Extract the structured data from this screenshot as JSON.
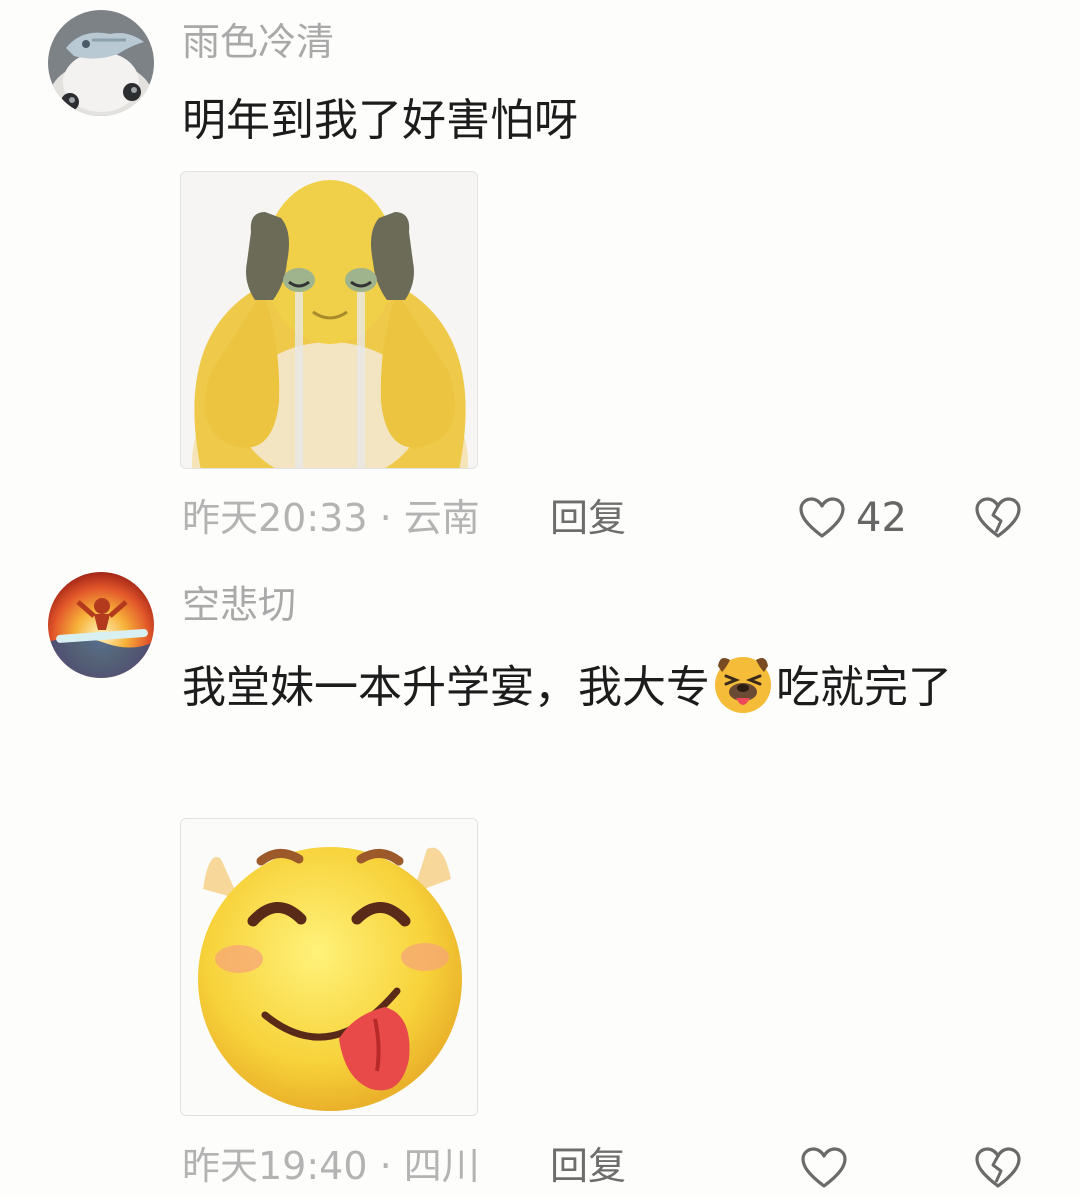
{
  "comments": [
    {
      "username": "雨色冷清",
      "text": "明年到我了好害怕呀",
      "time": "昨天20:33",
      "separator": "·",
      "location": "云南",
      "reply_label": "回复",
      "like_count": "42",
      "image_icon": "crying-yellow-character-sticker",
      "avatar_icon": "cat-with-fish-avatar"
    },
    {
      "username": "空悲切",
      "text_before": "我堂妹一本升学宴，我大专",
      "inline_emoji": "dog-tongue-emoji",
      "text_after": "吃就完了",
      "time": "昨天19:40",
      "separator": "·",
      "location": "四川",
      "reply_label": "回复",
      "image_icon": "smiling-tongue-emoji-sticker",
      "avatar_icon": "fire-surfer-avatar"
    }
  ],
  "icons": {
    "like": "heart-outline-icon",
    "dislike": "broken-heart-icon"
  },
  "colors": {
    "username": "#a9a9a9",
    "text": "#1c1c1c",
    "meta": "#b3b3b3",
    "reply": "#6d6d6d"
  }
}
